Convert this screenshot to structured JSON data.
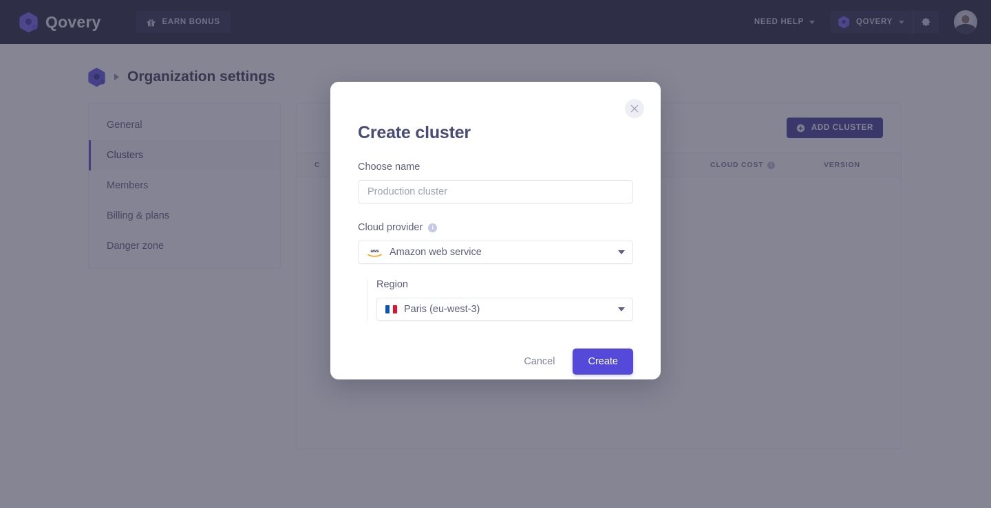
{
  "topbar": {
    "brand_name": "Qovery",
    "brand_logo_icon": "qovery-logo-icon",
    "earn_bonus_label": "EARN BONUS",
    "earn_bonus_icon": "gift-icon",
    "need_help_label": "NEED HELP",
    "need_help_caret_icon": "chevron-down-icon",
    "org_name": "QOVERY",
    "org_logo_icon": "qovery-mark-icon",
    "org_caret_icon": "chevron-down-icon",
    "settings_icon": "gear-icon",
    "avatar_icon": "user-avatar"
  },
  "breadcrumb": {
    "logo_icon": "qovery-mark-icon",
    "separator_icon": "chevron-right-icon",
    "title": "Organization settings"
  },
  "sidebar": {
    "items": [
      {
        "label": "General",
        "active": false
      },
      {
        "label": "Clusters",
        "active": true
      },
      {
        "label": "Members",
        "active": false
      },
      {
        "label": "Billing & plans",
        "active": false
      },
      {
        "label": "Danger zone",
        "active": false
      }
    ]
  },
  "content": {
    "add_cluster_label": "ADD CLUSTER",
    "add_cluster_icon": "plus-circle-icon",
    "table_headers": {
      "cluster": "C",
      "cloud_cost": "CLOUD COST",
      "cloud_cost_info_icon": "info-icon",
      "version": "VERSION"
    }
  },
  "modal": {
    "title": "Create cluster",
    "close_icon": "close-icon",
    "name_field": {
      "label": "Choose name",
      "value": "",
      "placeholder": "Production cluster"
    },
    "cloud_provider_field": {
      "label": "Cloud provider",
      "info_icon": "info-icon",
      "selected": "Amazon web service",
      "provider_icon": "aws-logo-icon",
      "caret_icon": "chevron-down-icon"
    },
    "region_field": {
      "label": "Region",
      "selected": "Paris (eu-west-3)",
      "flag_icon": "flag-france-icon",
      "caret_icon": "chevron-down-icon"
    },
    "cancel_label": "Cancel",
    "create_label": "Create"
  },
  "colors": {
    "topbar_bg": "#1c1c36",
    "accent_purple": "#5549d9",
    "accent_dark_purple": "#3b3590",
    "sidebar_active_bar": "#4f46c9",
    "overlay": "#3a3a52",
    "title_text": "#494c74"
  }
}
